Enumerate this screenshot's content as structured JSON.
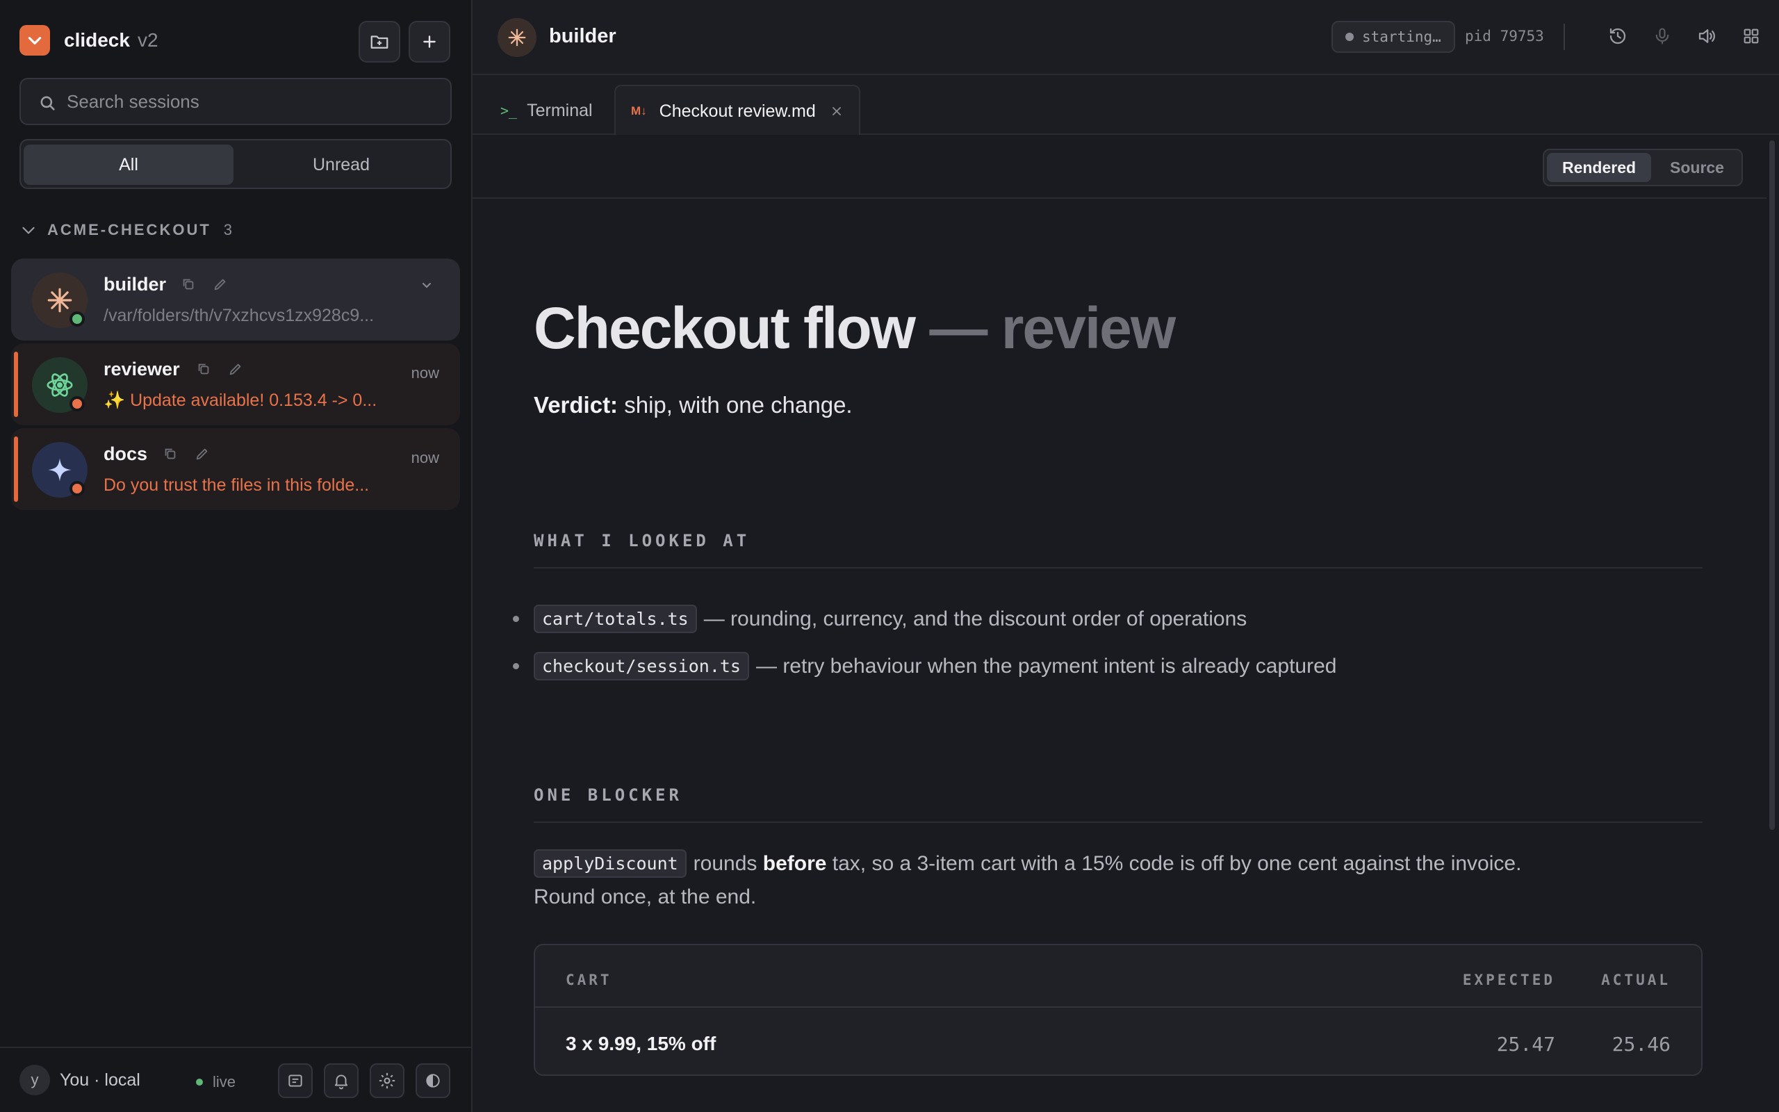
{
  "app": {
    "name": "clideck",
    "version": "v2"
  },
  "sidebar": {
    "search_placeholder": "Search sessions",
    "filters": {
      "all": "All",
      "unread": "Unread"
    },
    "group": {
      "name": "ACME-CHECKOUT",
      "count": "3"
    },
    "sessions": [
      {
        "name": "builder",
        "subtitle": "/var/folders/th/v7xzhcvs1zx928c9...",
        "time": ""
      },
      {
        "name": "reviewer",
        "subtitle": "✨  Update available! 0.153.4 -> 0...",
        "time": "now"
      },
      {
        "name": "docs",
        "subtitle": "Do you trust the files in this folde...",
        "time": "now"
      }
    ],
    "footer": {
      "avatar_letter": "y",
      "user": "You · local",
      "status": "live"
    }
  },
  "topbar": {
    "title": "builder",
    "status": "starting…",
    "pid": "pid 79753"
  },
  "tabs": [
    {
      "icon": ">_",
      "label": "Terminal"
    },
    {
      "icon": "M↓",
      "label": "Checkout review.md"
    }
  ],
  "viewmode": {
    "rendered": "Rendered",
    "source": "Source"
  },
  "document": {
    "title_main": "Checkout flow",
    "title_dim": " — review",
    "verdict_label": "Verdict:",
    "verdict_text": " ship, with one change.",
    "section1": "WHAT I LOOKED AT",
    "items": [
      {
        "code": "cart/totals.ts",
        "text": "— rounding, currency, and the discount order of operations"
      },
      {
        "code": "checkout/session.ts",
        "text": "— retry behaviour when the payment intent is already captured"
      }
    ],
    "section2": "ONE BLOCKER",
    "blocker": {
      "code": "applyDiscount",
      "pre": "rounds ",
      "bold": "before",
      "post": " tax, so a 3-item cart with a 15% code is off by one cent against the invoice.",
      "line2": "Round once, at the end."
    },
    "table": {
      "headers": [
        "CART",
        "EXPECTED",
        "ACTUAL"
      ],
      "rows": [
        [
          "3 x 9.99, 15% off",
          "25.47",
          "25.46"
        ]
      ]
    }
  },
  "colors": {
    "accent": "#e26a3d",
    "online": "#5fb878",
    "alert": "#e8734a"
  }
}
